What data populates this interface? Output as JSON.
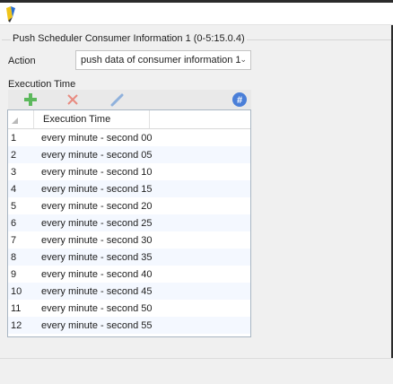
{
  "window": {
    "app_icon": "pen-logo-icon"
  },
  "group": {
    "title": "Push Scheduler Consumer Information 1 (0-5:15.0.4)"
  },
  "action": {
    "label": "Action",
    "selected": "push data of consumer information 1"
  },
  "execution": {
    "label": "Execution Time",
    "toolbar": {
      "add_icon": "add-icon",
      "delete_icon": "delete-icon",
      "edit_icon": "edit-icon",
      "number_icon": "hash-icon"
    },
    "column_header": "Execution Time",
    "rows": [
      {
        "num": "1",
        "value": "every minute - second 00"
      },
      {
        "num": "2",
        "value": "every minute - second 05"
      },
      {
        "num": "3",
        "value": "every minute - second 10"
      },
      {
        "num": "4",
        "value": "every minute - second 15"
      },
      {
        "num": "5",
        "value": "every minute - second 20"
      },
      {
        "num": "6",
        "value": "every minute - second 25"
      },
      {
        "num": "7",
        "value": "every minute - second 30"
      },
      {
        "num": "8",
        "value": "every minute - second 35"
      },
      {
        "num": "9",
        "value": "every minute - second 40"
      },
      {
        "num": "10",
        "value": "every minute - second 45"
      },
      {
        "num": "11",
        "value": "every minute - second 50"
      },
      {
        "num": "12",
        "value": "every minute - second 55"
      }
    ]
  },
  "colors": {
    "accent": "#3c77d8",
    "add": "#5cb85c",
    "delete": "#e56c5c"
  }
}
